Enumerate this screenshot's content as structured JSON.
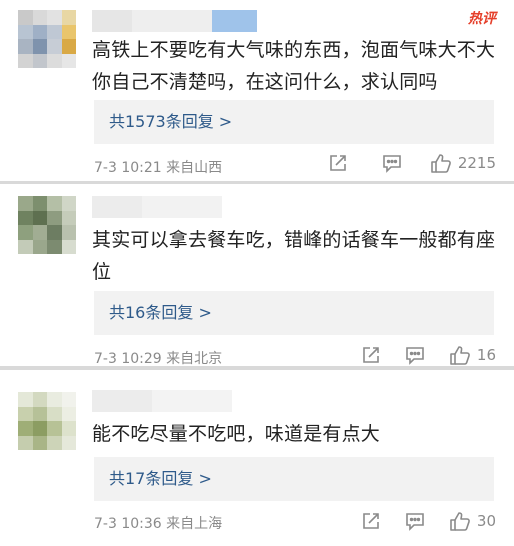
{
  "comments": [
    {
      "hot_badge": "热评",
      "text": "高铁上不要吃有大气味的东西，泡面气味大不大你自己不清楚吗，在这问什么，求认同吗",
      "replies": "共1573条回复 >",
      "time_location": "7-3 10:21  来自山西",
      "likes": "2215"
    },
    {
      "text": "其实可以拿去餐车吃，错峰的话餐车一般都有座位",
      "replies": "共16条回复 >",
      "time_location": "7-3 10:29  来自北京",
      "likes": "16"
    },
    {
      "text": "能不吃尽量不吃吧，味道是有点大",
      "replies": "共17条回复 >",
      "time_location": "7-3 10:36  来自上海",
      "likes": "30"
    }
  ],
  "icons": [
    "share-icon",
    "comment-icon",
    "like-icon"
  ],
  "colors": {
    "reply_link": "#2e5a8a",
    "hot_badge": "#e5402b",
    "meta_text": "#8a8a8a",
    "reply_bg": "#f2f2f2"
  }
}
